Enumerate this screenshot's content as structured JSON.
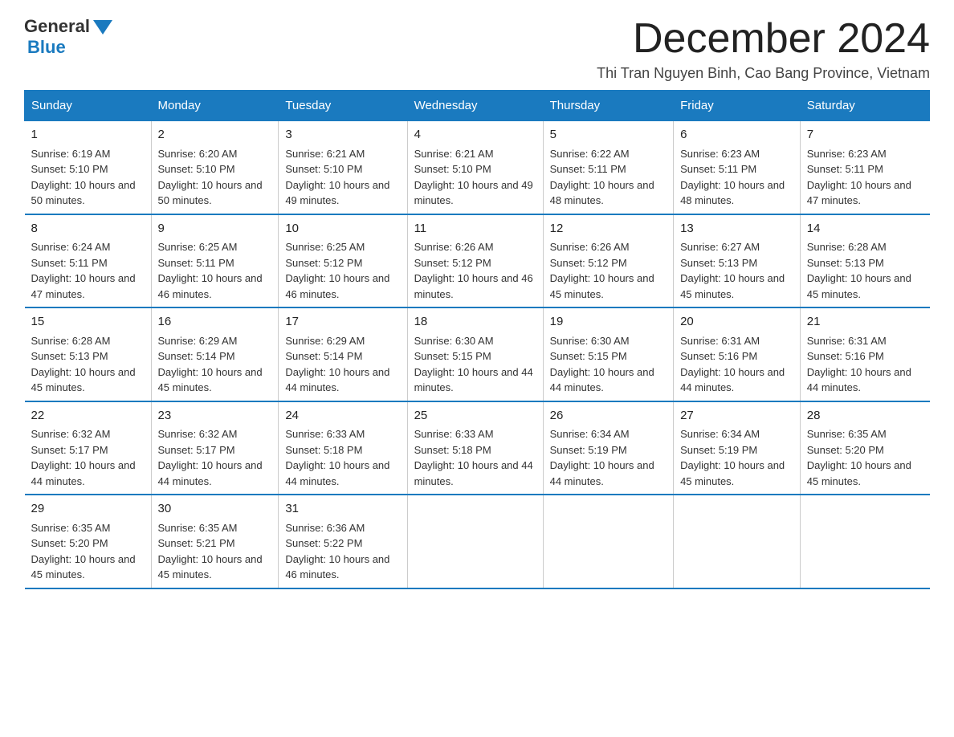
{
  "logo": {
    "general": "General",
    "blue": "Blue"
  },
  "header": {
    "month_title": "December 2024",
    "location": "Thi Tran Nguyen Binh, Cao Bang Province, Vietnam"
  },
  "days_of_week": [
    "Sunday",
    "Monday",
    "Tuesday",
    "Wednesday",
    "Thursday",
    "Friday",
    "Saturday"
  ],
  "weeks": [
    [
      {
        "day": "1",
        "sunrise": "6:19 AM",
        "sunset": "5:10 PM",
        "daylight": "10 hours and 50 minutes."
      },
      {
        "day": "2",
        "sunrise": "6:20 AM",
        "sunset": "5:10 PM",
        "daylight": "10 hours and 50 minutes."
      },
      {
        "day": "3",
        "sunrise": "6:21 AM",
        "sunset": "5:10 PM",
        "daylight": "10 hours and 49 minutes."
      },
      {
        "day": "4",
        "sunrise": "6:21 AM",
        "sunset": "5:10 PM",
        "daylight": "10 hours and 49 minutes."
      },
      {
        "day": "5",
        "sunrise": "6:22 AM",
        "sunset": "5:11 PM",
        "daylight": "10 hours and 48 minutes."
      },
      {
        "day": "6",
        "sunrise": "6:23 AM",
        "sunset": "5:11 PM",
        "daylight": "10 hours and 48 minutes."
      },
      {
        "day": "7",
        "sunrise": "6:23 AM",
        "sunset": "5:11 PM",
        "daylight": "10 hours and 47 minutes."
      }
    ],
    [
      {
        "day": "8",
        "sunrise": "6:24 AM",
        "sunset": "5:11 PM",
        "daylight": "10 hours and 47 minutes."
      },
      {
        "day": "9",
        "sunrise": "6:25 AM",
        "sunset": "5:11 PM",
        "daylight": "10 hours and 46 minutes."
      },
      {
        "day": "10",
        "sunrise": "6:25 AM",
        "sunset": "5:12 PM",
        "daylight": "10 hours and 46 minutes."
      },
      {
        "day": "11",
        "sunrise": "6:26 AM",
        "sunset": "5:12 PM",
        "daylight": "10 hours and 46 minutes."
      },
      {
        "day": "12",
        "sunrise": "6:26 AM",
        "sunset": "5:12 PM",
        "daylight": "10 hours and 45 minutes."
      },
      {
        "day": "13",
        "sunrise": "6:27 AM",
        "sunset": "5:13 PM",
        "daylight": "10 hours and 45 minutes."
      },
      {
        "day": "14",
        "sunrise": "6:28 AM",
        "sunset": "5:13 PM",
        "daylight": "10 hours and 45 minutes."
      }
    ],
    [
      {
        "day": "15",
        "sunrise": "6:28 AM",
        "sunset": "5:13 PM",
        "daylight": "10 hours and 45 minutes."
      },
      {
        "day": "16",
        "sunrise": "6:29 AM",
        "sunset": "5:14 PM",
        "daylight": "10 hours and 45 minutes."
      },
      {
        "day": "17",
        "sunrise": "6:29 AM",
        "sunset": "5:14 PM",
        "daylight": "10 hours and 44 minutes."
      },
      {
        "day": "18",
        "sunrise": "6:30 AM",
        "sunset": "5:15 PM",
        "daylight": "10 hours and 44 minutes."
      },
      {
        "day": "19",
        "sunrise": "6:30 AM",
        "sunset": "5:15 PM",
        "daylight": "10 hours and 44 minutes."
      },
      {
        "day": "20",
        "sunrise": "6:31 AM",
        "sunset": "5:16 PM",
        "daylight": "10 hours and 44 minutes."
      },
      {
        "day": "21",
        "sunrise": "6:31 AM",
        "sunset": "5:16 PM",
        "daylight": "10 hours and 44 minutes."
      }
    ],
    [
      {
        "day": "22",
        "sunrise": "6:32 AM",
        "sunset": "5:17 PM",
        "daylight": "10 hours and 44 minutes."
      },
      {
        "day": "23",
        "sunrise": "6:32 AM",
        "sunset": "5:17 PM",
        "daylight": "10 hours and 44 minutes."
      },
      {
        "day": "24",
        "sunrise": "6:33 AM",
        "sunset": "5:18 PM",
        "daylight": "10 hours and 44 minutes."
      },
      {
        "day": "25",
        "sunrise": "6:33 AM",
        "sunset": "5:18 PM",
        "daylight": "10 hours and 44 minutes."
      },
      {
        "day": "26",
        "sunrise": "6:34 AM",
        "sunset": "5:19 PM",
        "daylight": "10 hours and 44 minutes."
      },
      {
        "day": "27",
        "sunrise": "6:34 AM",
        "sunset": "5:19 PM",
        "daylight": "10 hours and 45 minutes."
      },
      {
        "day": "28",
        "sunrise": "6:35 AM",
        "sunset": "5:20 PM",
        "daylight": "10 hours and 45 minutes."
      }
    ],
    [
      {
        "day": "29",
        "sunrise": "6:35 AM",
        "sunset": "5:20 PM",
        "daylight": "10 hours and 45 minutes."
      },
      {
        "day": "30",
        "sunrise": "6:35 AM",
        "sunset": "5:21 PM",
        "daylight": "10 hours and 45 minutes."
      },
      {
        "day": "31",
        "sunrise": "6:36 AM",
        "sunset": "5:22 PM",
        "daylight": "10 hours and 46 minutes."
      },
      null,
      null,
      null,
      null
    ]
  ]
}
